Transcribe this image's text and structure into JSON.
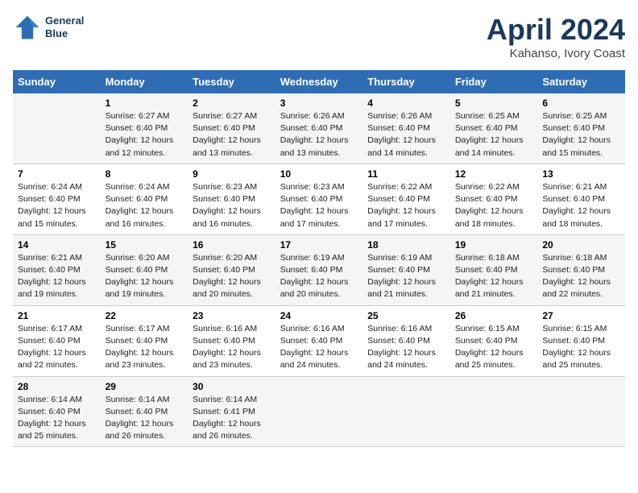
{
  "header": {
    "logo_line1": "General",
    "logo_line2": "Blue",
    "title": "April 2024",
    "subtitle": "Kahanso, Ivory Coast"
  },
  "weekdays": [
    "Sunday",
    "Monday",
    "Tuesday",
    "Wednesday",
    "Thursday",
    "Friday",
    "Saturday"
  ],
  "weeks": [
    [
      {
        "num": "",
        "info": ""
      },
      {
        "num": "1",
        "info": "Sunrise: 6:27 AM\nSunset: 6:40 PM\nDaylight: 12 hours\nand 12 minutes."
      },
      {
        "num": "2",
        "info": "Sunrise: 6:27 AM\nSunset: 6:40 PM\nDaylight: 12 hours\nand 13 minutes."
      },
      {
        "num": "3",
        "info": "Sunrise: 6:26 AM\nSunset: 6:40 PM\nDaylight: 12 hours\nand 13 minutes."
      },
      {
        "num": "4",
        "info": "Sunrise: 6:26 AM\nSunset: 6:40 PM\nDaylight: 12 hours\nand 14 minutes."
      },
      {
        "num": "5",
        "info": "Sunrise: 6:25 AM\nSunset: 6:40 PM\nDaylight: 12 hours\nand 14 minutes."
      },
      {
        "num": "6",
        "info": "Sunrise: 6:25 AM\nSunset: 6:40 PM\nDaylight: 12 hours\nand 15 minutes."
      }
    ],
    [
      {
        "num": "7",
        "info": "Sunrise: 6:24 AM\nSunset: 6:40 PM\nDaylight: 12 hours\nand 15 minutes."
      },
      {
        "num": "8",
        "info": "Sunrise: 6:24 AM\nSunset: 6:40 PM\nDaylight: 12 hours\nand 16 minutes."
      },
      {
        "num": "9",
        "info": "Sunrise: 6:23 AM\nSunset: 6:40 PM\nDaylight: 12 hours\nand 16 minutes."
      },
      {
        "num": "10",
        "info": "Sunrise: 6:23 AM\nSunset: 6:40 PM\nDaylight: 12 hours\nand 17 minutes."
      },
      {
        "num": "11",
        "info": "Sunrise: 6:22 AM\nSunset: 6:40 PM\nDaylight: 12 hours\nand 17 minutes."
      },
      {
        "num": "12",
        "info": "Sunrise: 6:22 AM\nSunset: 6:40 PM\nDaylight: 12 hours\nand 18 minutes."
      },
      {
        "num": "13",
        "info": "Sunrise: 6:21 AM\nSunset: 6:40 PM\nDaylight: 12 hours\nand 18 minutes."
      }
    ],
    [
      {
        "num": "14",
        "info": "Sunrise: 6:21 AM\nSunset: 6:40 PM\nDaylight: 12 hours\nand 19 minutes."
      },
      {
        "num": "15",
        "info": "Sunrise: 6:20 AM\nSunset: 6:40 PM\nDaylight: 12 hours\nand 19 minutes."
      },
      {
        "num": "16",
        "info": "Sunrise: 6:20 AM\nSunset: 6:40 PM\nDaylight: 12 hours\nand 20 minutes."
      },
      {
        "num": "17",
        "info": "Sunrise: 6:19 AM\nSunset: 6:40 PM\nDaylight: 12 hours\nand 20 minutes."
      },
      {
        "num": "18",
        "info": "Sunrise: 6:19 AM\nSunset: 6:40 PM\nDaylight: 12 hours\nand 21 minutes."
      },
      {
        "num": "19",
        "info": "Sunrise: 6:18 AM\nSunset: 6:40 PM\nDaylight: 12 hours\nand 21 minutes."
      },
      {
        "num": "20",
        "info": "Sunrise: 6:18 AM\nSunset: 6:40 PM\nDaylight: 12 hours\nand 22 minutes."
      }
    ],
    [
      {
        "num": "21",
        "info": "Sunrise: 6:17 AM\nSunset: 6:40 PM\nDaylight: 12 hours\nand 22 minutes."
      },
      {
        "num": "22",
        "info": "Sunrise: 6:17 AM\nSunset: 6:40 PM\nDaylight: 12 hours\nand 23 minutes."
      },
      {
        "num": "23",
        "info": "Sunrise: 6:16 AM\nSunset: 6:40 PM\nDaylight: 12 hours\nand 23 minutes."
      },
      {
        "num": "24",
        "info": "Sunrise: 6:16 AM\nSunset: 6:40 PM\nDaylight: 12 hours\nand 24 minutes."
      },
      {
        "num": "25",
        "info": "Sunrise: 6:16 AM\nSunset: 6:40 PM\nDaylight: 12 hours\nand 24 minutes."
      },
      {
        "num": "26",
        "info": "Sunrise: 6:15 AM\nSunset: 6:40 PM\nDaylight: 12 hours\nand 25 minutes."
      },
      {
        "num": "27",
        "info": "Sunrise: 6:15 AM\nSunset: 6:40 PM\nDaylight: 12 hours\nand 25 minutes."
      }
    ],
    [
      {
        "num": "28",
        "info": "Sunrise: 6:14 AM\nSunset: 6:40 PM\nDaylight: 12 hours\nand 25 minutes."
      },
      {
        "num": "29",
        "info": "Sunrise: 6:14 AM\nSunset: 6:40 PM\nDaylight: 12 hours\nand 26 minutes."
      },
      {
        "num": "30",
        "info": "Sunrise: 6:14 AM\nSunset: 6:41 PM\nDaylight: 12 hours\nand 26 minutes."
      },
      {
        "num": "",
        "info": ""
      },
      {
        "num": "",
        "info": ""
      },
      {
        "num": "",
        "info": ""
      },
      {
        "num": "",
        "info": ""
      }
    ]
  ]
}
